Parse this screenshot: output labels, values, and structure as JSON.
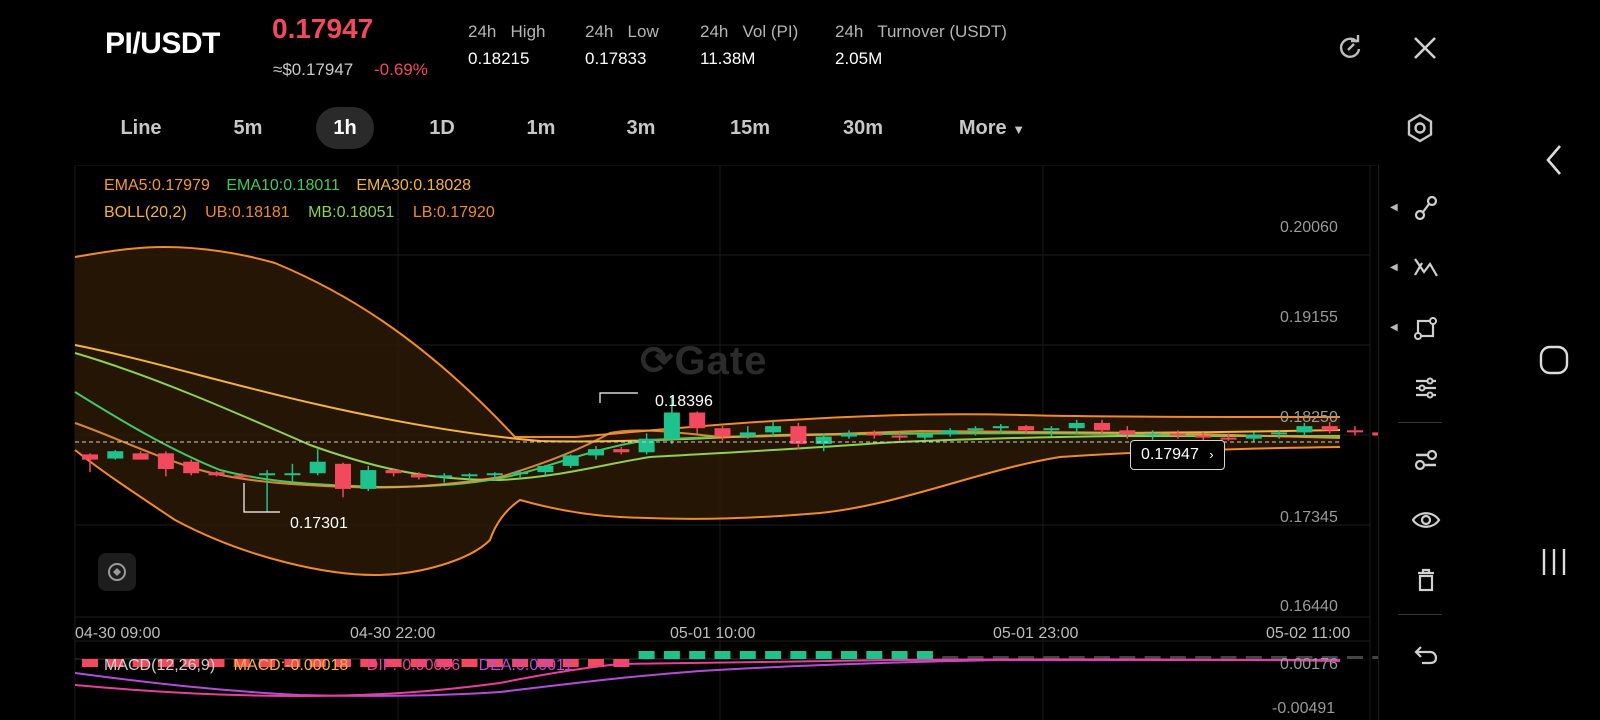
{
  "header": {
    "pair": "PI/USDT",
    "price": "0.17947",
    "approx": "≈$0.17947",
    "change": "-0.69%",
    "stats": [
      {
        "label": "24h   High",
        "value": "0.18215"
      },
      {
        "label": "24h   Low",
        "value": "0.17833"
      },
      {
        "label": "24h   Vol (PI)",
        "value": "11.38M"
      },
      {
        "label": "24h   Turnover (USDT)",
        "value": "2.05M"
      }
    ]
  },
  "tabs": [
    "Line",
    "5m",
    "1h",
    "1D",
    "1m",
    "3m",
    "15m",
    "30m",
    "More"
  ],
  "active_tab": "1h",
  "indicators": {
    "ema5": "EMA5:0.17979",
    "ema10": "EMA10:0.18011",
    "ema30": "EMA30:0.18028",
    "boll": "BOLL(20,2)",
    "ub": "UB:0.18181",
    "mb": "MB:0.18051",
    "lb": "LB:0.17920"
  },
  "watermark": "Gate",
  "price_axis": [
    "0.20060",
    "0.19155",
    "0.18250",
    "0.17345",
    "0.16440"
  ],
  "time_axis": [
    "04-30 09:00",
    "04-30 22:00",
    "05-01 10:00",
    "05-01 23:00",
    "05-02 11:00"
  ],
  "annotations": {
    "high_marker": "0.18396",
    "low_marker": "0.17301",
    "current_price_tag": "0.17947"
  },
  "macd": {
    "title": "MACD(12,26,9)",
    "macd": "MACD:-0.00018",
    "dif": "DIF:-0.00006",
    "dea": "DEA:0.00011",
    "axis": [
      "0.00176",
      "-0.00491"
    ]
  },
  "colors": {
    "up": "#1fc18c",
    "down": "#f2495e",
    "ema5": "#f59a3a",
    "ema10": "#43c75f",
    "ema30": "#f5b43a",
    "boll": "#f08a2c",
    "mb": "#8fd14f",
    "dea": "#b44cd8",
    "dif": "#e6409a"
  },
  "chart_data": {
    "type": "candlestick",
    "timeframe": "1h",
    "ylim": [
      0.1644,
      0.2006
    ],
    "yticks": [
      0.2006,
      0.19155,
      0.1825,
      0.17345,
      0.1644
    ],
    "x_labels": [
      "04-30 09:00",
      "04-30 22:00",
      "05-01 10:00",
      "05-01 23:00",
      "05-02 11:00"
    ],
    "current_price": 0.17947,
    "marked_high": 0.18396,
    "marked_low": 0.17301,
    "candles_approx": [
      {
        "o": 0.1785,
        "h": 0.1786,
        "l": 0.1768,
        "c": 0.178
      },
      {
        "o": 0.1781,
        "h": 0.1789,
        "l": 0.178,
        "c": 0.1788
      },
      {
        "o": 0.1786,
        "h": 0.1788,
        "l": 0.178,
        "c": 0.178
      },
      {
        "o": 0.1786,
        "h": 0.1788,
        "l": 0.1764,
        "c": 0.1771
      },
      {
        "o": 0.1778,
        "h": 0.178,
        "l": 0.1765,
        "c": 0.1767
      },
      {
        "o": 0.1768,
        "h": 0.1769,
        "l": 0.1764,
        "c": 0.1765
      },
      {
        "o": 0.1765,
        "h": 0.1767,
        "l": 0.1762,
        "c": 0.1764
      },
      {
        "o": 0.1765,
        "h": 0.177,
        "l": 0.173,
        "c": 0.1767
      },
      {
        "o": 0.1766,
        "h": 0.1776,
        "l": 0.1758,
        "c": 0.1767
      },
      {
        "o": 0.1767,
        "h": 0.179,
        "l": 0.1765,
        "c": 0.1778
      },
      {
        "o": 0.1776,
        "h": 0.1777,
        "l": 0.1744,
        "c": 0.1752
      },
      {
        "o": 0.1752,
        "h": 0.1774,
        "l": 0.175,
        "c": 0.177
      },
      {
        "o": 0.177,
        "h": 0.1772,
        "l": 0.1764,
        "c": 0.1767
      },
      {
        "o": 0.1766,
        "h": 0.1768,
        "l": 0.1761,
        "c": 0.1763
      },
      {
        "o": 0.1763,
        "h": 0.1767,
        "l": 0.1758,
        "c": 0.1765
      },
      {
        "o": 0.1765,
        "h": 0.1767,
        "l": 0.176,
        "c": 0.1766
      },
      {
        "o": 0.1766,
        "h": 0.1768,
        "l": 0.176,
        "c": 0.1767
      },
      {
        "o": 0.1767,
        "h": 0.1769,
        "l": 0.1762,
        "c": 0.1768
      },
      {
        "o": 0.1768,
        "h": 0.1775,
        "l": 0.1765,
        "c": 0.1774
      },
      {
        "o": 0.1774,
        "h": 0.1785,
        "l": 0.1772,
        "c": 0.1784
      },
      {
        "o": 0.1784,
        "h": 0.1793,
        "l": 0.178,
        "c": 0.179
      },
      {
        "o": 0.179,
        "h": 0.1792,
        "l": 0.1785,
        "c": 0.1787
      },
      {
        "o": 0.1787,
        "h": 0.1805,
        "l": 0.1785,
        "c": 0.18
      },
      {
        "o": 0.18,
        "h": 0.184,
        "l": 0.1795,
        "c": 0.1825
      },
      {
        "o": 0.1825,
        "h": 0.1826,
        "l": 0.1805,
        "c": 0.181
      },
      {
        "o": 0.181,
        "h": 0.1812,
        "l": 0.1798,
        "c": 0.1802
      },
      {
        "o": 0.1802,
        "h": 0.1812,
        "l": 0.18,
        "c": 0.1806
      },
      {
        "o": 0.1806,
        "h": 0.1818,
        "l": 0.1802,
        "c": 0.1812
      },
      {
        "o": 0.1812,
        "h": 0.1815,
        "l": 0.179,
        "c": 0.1795
      },
      {
        "o": 0.1795,
        "h": 0.1805,
        "l": 0.1788,
        "c": 0.1802
      },
      {
        "o": 0.1802,
        "h": 0.1808,
        "l": 0.18,
        "c": 0.1805
      },
      {
        "o": 0.1805,
        "h": 0.1808,
        "l": 0.18,
        "c": 0.1803
      },
      {
        "o": 0.1803,
        "h": 0.1806,
        "l": 0.1798,
        "c": 0.1801
      },
      {
        "o": 0.1801,
        "h": 0.1805,
        "l": 0.1799,
        "c": 0.1804
      },
      {
        "o": 0.1804,
        "h": 0.181,
        "l": 0.1802,
        "c": 0.1808
      },
      {
        "o": 0.1808,
        "h": 0.1812,
        "l": 0.1803,
        "c": 0.181
      },
      {
        "o": 0.181,
        "h": 0.1814,
        "l": 0.1805,
        "c": 0.1812
      },
      {
        "o": 0.1812,
        "h": 0.1813,
        "l": 0.1805,
        "c": 0.1808
      },
      {
        "o": 0.1808,
        "h": 0.1812,
        "l": 0.1802,
        "c": 0.181
      },
      {
        "o": 0.181,
        "h": 0.1818,
        "l": 0.1805,
        "c": 0.1815
      },
      {
        "o": 0.1815,
        "h": 0.1818,
        "l": 0.1805,
        "c": 0.1808
      },
      {
        "o": 0.1808,
        "h": 0.1812,
        "l": 0.18,
        "c": 0.1804
      },
      {
        "o": 0.1804,
        "h": 0.1808,
        "l": 0.1799,
        "c": 0.1805
      },
      {
        "o": 0.1805,
        "h": 0.1808,
        "l": 0.18,
        "c": 0.1803
      },
      {
        "o": 0.1803,
        "h": 0.1806,
        "l": 0.1798,
        "c": 0.1801
      },
      {
        "o": 0.1801,
        "h": 0.1805,
        "l": 0.1798,
        "c": 0.18
      },
      {
        "o": 0.18,
        "h": 0.1806,
        "l": 0.1797,
        "c": 0.1804
      },
      {
        "o": 0.1804,
        "h": 0.1808,
        "l": 0.18,
        "c": 0.1806
      },
      {
        "o": 0.1806,
        "h": 0.1815,
        "l": 0.1803,
        "c": 0.1812
      },
      {
        "o": 0.1812,
        "h": 0.1816,
        "l": 0.1805,
        "c": 0.1808
      },
      {
        "o": 0.1808,
        "h": 0.1812,
        "l": 0.1803,
        "c": 0.1806
      },
      {
        "o": 0.1806,
        "h": 0.1809,
        "l": 0.1801,
        "c": 0.1803
      },
      {
        "o": 0.1803,
        "h": 0.1806,
        "l": 0.1796,
        "c": 0.1798
      },
      {
        "o": 0.1798,
        "h": 0.1802,
        "l": 0.1794,
        "c": 0.1797
      },
      {
        "o": 0.1797,
        "h": 0.18,
        "l": 0.1793,
        "c": 0.1795
      }
    ]
  }
}
